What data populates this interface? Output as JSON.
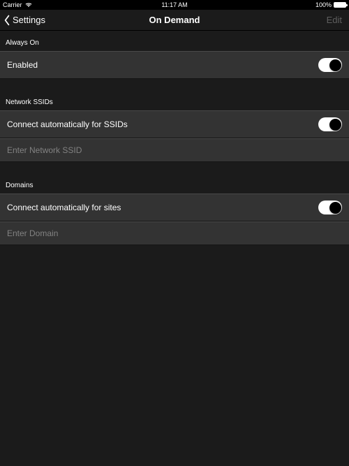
{
  "status_bar": {
    "carrier": "Carrier",
    "time": "11:17 AM",
    "battery_percent": "100%"
  },
  "nav": {
    "back_label": "Settings",
    "title": "On Demand",
    "edit_label": "Edit"
  },
  "sections": {
    "always_on": {
      "header": "Always On",
      "enabled_label": "Enabled",
      "enabled_value": true
    },
    "ssids": {
      "header": "Network SSIDs",
      "toggle_label": "Connect automatically for SSIDs",
      "toggle_value": true,
      "input_placeholder": "Enter Network SSID"
    },
    "domains": {
      "header": "Domains",
      "toggle_label": "Connect automatically for sites",
      "toggle_value": true,
      "input_placeholder": "Enter Domain"
    }
  }
}
